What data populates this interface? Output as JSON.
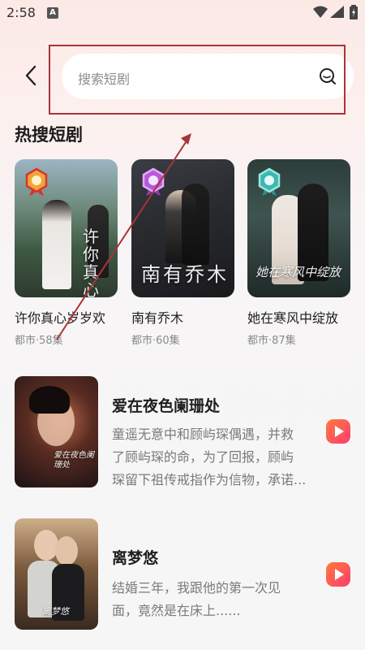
{
  "status": {
    "time": "2:58",
    "indicator": "A"
  },
  "search": {
    "placeholder": "搜索短剧"
  },
  "section": {
    "title": "热搜短剧"
  },
  "hot": [
    {
      "name": "许你真心岁岁欢",
      "meta": "都市·58集",
      "medal": "gold",
      "cover_text": "许你真心岁岁欢"
    },
    {
      "name": "南有乔木",
      "meta": "都市·60集",
      "medal": "purple",
      "cover_text": "南有乔木"
    },
    {
      "name": "她在寒风中绽放",
      "meta": "都市·87集",
      "medal": "teal",
      "cover_text": "她在寒风中绽放"
    }
  ],
  "list": [
    {
      "title": "爱在夜色阑珊处",
      "desc": "童遥无意中和顾屿琛偶遇，并救了顾屿琛的命，为了回报，顾屿琛留下祖传戒指作为信物，承诺…",
      "desc_lines": [
        "童遥无意中和顾屿琛偶遇，并救",
        "了顾屿琛的命，为了回报，顾屿",
        "琛留下祖传戒指作为信物，承诺..."
      ],
      "cover_text": "爱在夜色阑珊处"
    },
    {
      "title": "离梦悠",
      "desc_lines": [
        "结婚三年，我跟他的第一次见",
        "面，竟然是在床上......"
      ],
      "cover_text": "离梦悠"
    }
  ],
  "colors": {
    "accent_play": "#ff4d6d",
    "annotation": "#a8343a"
  }
}
